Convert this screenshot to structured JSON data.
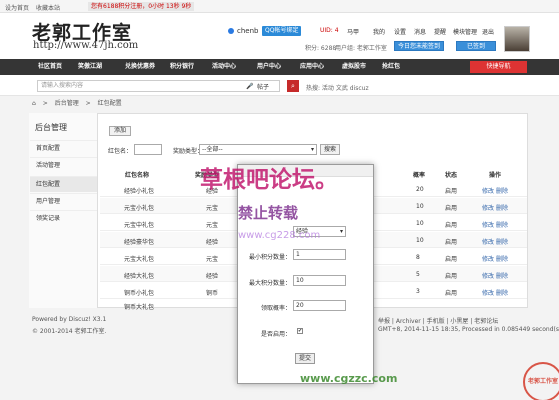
{
  "topbar": {
    "set_home": "设为首页",
    "bookmark": "收藏本站",
    "notice": "您有6188积分注册，0小时 13秒 9秒"
  },
  "header": {
    "logo_text": "老郭工作室",
    "logo_url": "http://www.47jh.com",
    "username": "chenb",
    "qq_badge": "QQ帐号绑定",
    "uid": "UID: 4",
    "links": [
      "马甲",
      "我的",
      "设置",
      "消息",
      "提醒",
      "模块管理",
      "退出"
    ],
    "credits": "积分: 6288",
    "user_level": "用户组: 老郭工作室",
    "signin_btn": "今日您未能签到",
    "signed_btn": "已签到"
  },
  "nav": {
    "items": [
      "社区首页",
      "笑傲江湖",
      "兑换优惠券",
      "积分银行",
      "活动中心",
      "用户中心",
      "应用中心",
      "虚拟股市",
      "抢红包"
    ],
    "quick_nav": "快捷导航"
  },
  "search": {
    "placeholder": "请输入搜索内容",
    "type": "帖子",
    "hot_label": "热搜: 活动 文武 discuz"
  },
  "breadcrumb": [
    "⌂",
    ">",
    "后台管理",
    ">",
    "红包配置"
  ],
  "sidebar": {
    "title": "后台管理",
    "items": [
      "首页配置",
      "活动管理",
      "红包配置",
      "用户管理",
      "领奖记录"
    ]
  },
  "filter": {
    "add_btn": "添加",
    "name_label": "红包名：",
    "type_label": "奖励类型：",
    "type_value": "--全部--",
    "search_btn": "搜索"
  },
  "table": {
    "headers": [
      "红包名称",
      "奖励类型",
      "积分",
      "概率",
      "状态",
      "操作"
    ],
    "rows": [
      {
        "name": "经验小礼包",
        "type": "经验",
        "prob": "20",
        "status": "启用"
      },
      {
        "name": "元宝小礼包",
        "type": "元宝",
        "prob": "10",
        "status": "启用"
      },
      {
        "name": "元宝中礼包",
        "type": "元宝",
        "prob": "10",
        "status": "启用"
      },
      {
        "name": "经验豪华包",
        "type": "经验",
        "prob": "10",
        "status": "启用"
      },
      {
        "name": "元宝大礼包",
        "type": "元宝",
        "prob": "8",
        "status": "启用"
      },
      {
        "name": "经验大礼包",
        "type": "经验",
        "prob": "5",
        "status": "启用"
      },
      {
        "name": "铜币小礼包",
        "type": "铜币",
        "prob": "3",
        "status": "启用"
      },
      {
        "name": "铜币大礼包",
        "type": "铜币",
        "prob": "10",
        "status": "启用"
      }
    ],
    "edit_label": "修改",
    "delete_label": "删除"
  },
  "modal": {
    "select_value": "经验",
    "min_label": "最小积分数量：",
    "min_value": "1",
    "max_label": "最大积分数量：",
    "max_value": "10",
    "prob_label": "领取概率：",
    "prob_value": "20",
    "enable_label": "是否启用：",
    "submit_label": "提交"
  },
  "footer": {
    "powered": "Powered by Discuz! X3.1",
    "copyright": "© 2001-2014 老郭工作室.",
    "right1": "举报 | Archiver | 手机版 | 小黑屋 | 老郭论坛",
    "right2": "GMT+8, 2014-11-15 18:35, Processed in 0.085449 second(s), 19 queries , Xcache On."
  },
  "watermark": {
    "line1": "草根吧论坛。",
    "line2": "禁止转载",
    "line3": "www.cg228.com",
    "line4": "www.cgzzc.com",
    "stamp": "老郭工作室"
  }
}
